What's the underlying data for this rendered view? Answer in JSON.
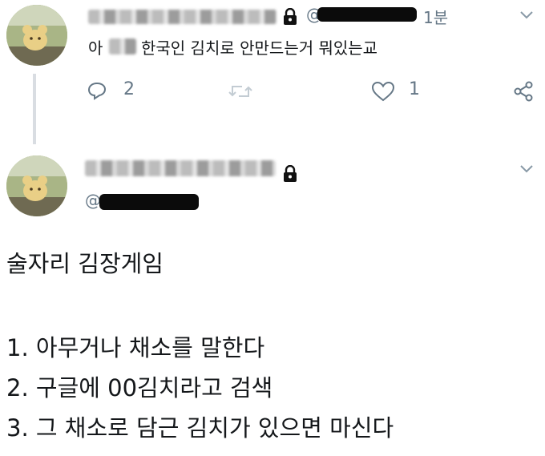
{
  "tweet1": {
    "handle_prefix": "@",
    "time": "1분",
    "text_prefix": "아",
    "text_main": "한국인 김치로 안만드는거 뭐있는교",
    "actions": {
      "reply_count": "2",
      "like_count": "1"
    }
  },
  "tweet2": {
    "handle_prefix": "@",
    "lines": [
      "술자리 김장게임",
      "1. 아무거나 채소를 말한다",
      "2. 구글에 00김치라고 검색",
      "3. 그 채소로 담근 김치가 있으면 마신다"
    ]
  },
  "colors": {
    "text": "#14171a",
    "secondary": "#657786",
    "thread_line": "#d9dde2"
  },
  "icons": [
    "lock-icon",
    "chevron-down-icon",
    "reply-icon",
    "retweet-icon",
    "like-icon",
    "share-icon"
  ]
}
